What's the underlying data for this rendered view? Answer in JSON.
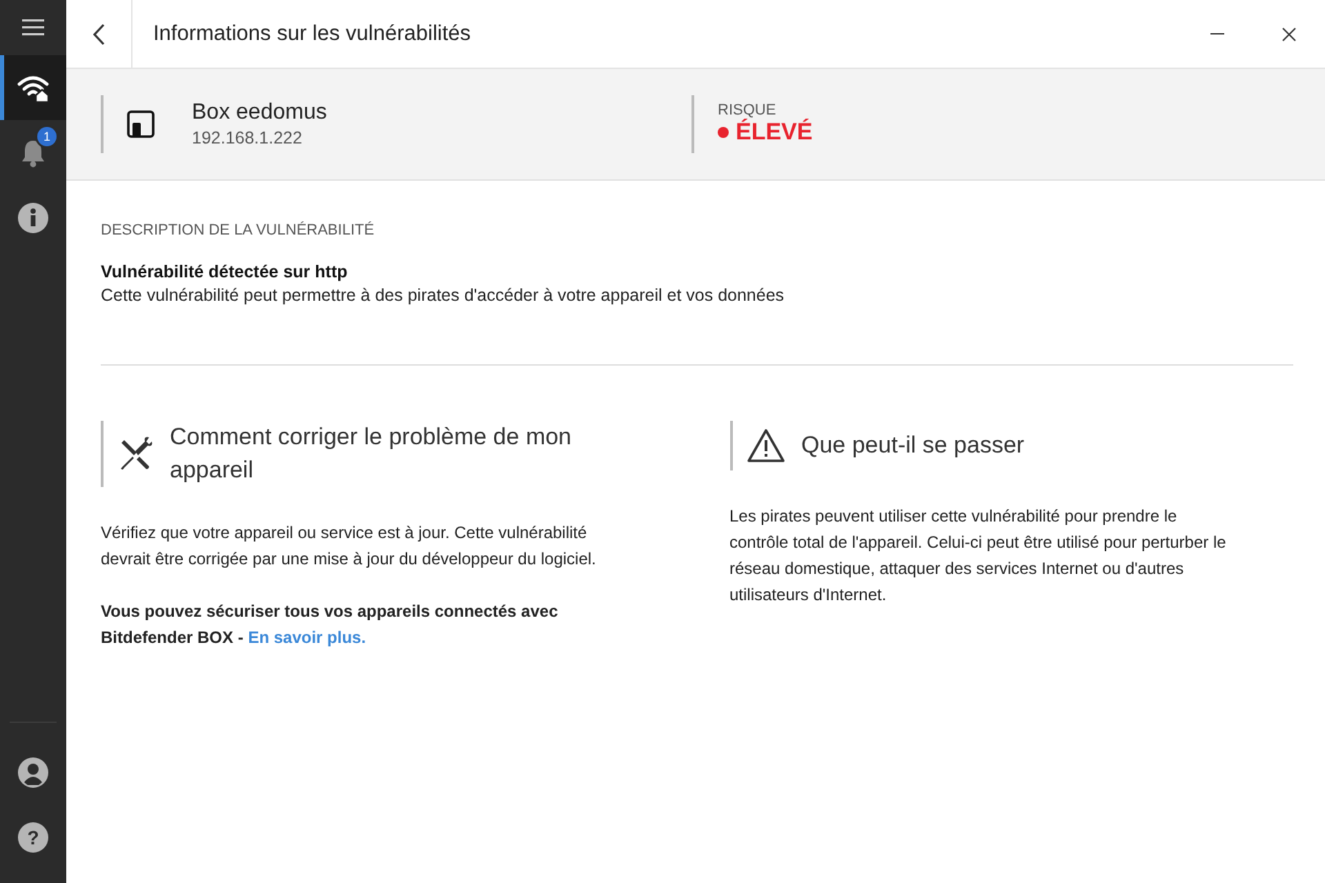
{
  "sidebar": {
    "top_items": [
      {
        "kind": "menu",
        "selected": false
      },
      {
        "kind": "network",
        "selected": true
      },
      {
        "kind": "notifications",
        "selected": false,
        "badge": "1"
      },
      {
        "kind": "info",
        "selected": false
      }
    ],
    "bottom_items": [
      {
        "kind": "account",
        "selected": false
      },
      {
        "kind": "help",
        "selected": false,
        "glyph": "?"
      }
    ]
  },
  "header": {
    "title": "Informations sur les vulnérabilités"
  },
  "device": {
    "name": "Box eedomus",
    "ip": "192.168.1.222",
    "risk": {
      "label": "RISQUE",
      "value": "ÉLEVÉ",
      "color": "#e8232e"
    }
  },
  "description": {
    "heading": "DESCRIPTION DE LA VULNÉRABILITÉ",
    "title": "Vulnérabilité détectée sur http",
    "text": "Cette vulnérabilité peut permettre à des pirates d'accéder à votre appareil et vos données"
  },
  "sections": [
    {
      "kind": "fix",
      "title": "Comment corriger le problème de mon appareil",
      "paragraphs": [
        "Vérifiez que votre appareil ou service est à jour. Cette vulnérabilité devrait être corrigée par une mise à jour du développeur du logiciel."
      ],
      "promo": "Vous pouvez sécuriser tous vos appareils connectés avec Bitdefender BOX - ",
      "link": "En savoir plus."
    },
    {
      "kind": "warning",
      "title": "Que peut-il se passer",
      "paragraphs": [
        "Les pirates peuvent utiliser cette vulnérabilité pour prendre le contrôle total de l'appareil. Celui-ci peut être utilisé pour perturber le réseau domestique, attaquer des services Internet ou d'autres utilisateurs d'Internet."
      ]
    }
  ]
}
